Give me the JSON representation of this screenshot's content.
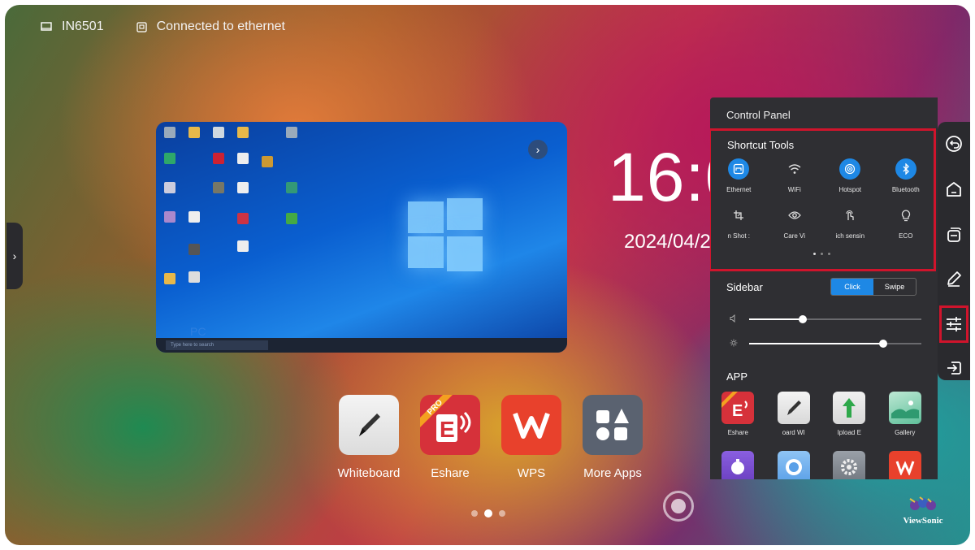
{
  "status_bar": {
    "device": "IN6501",
    "network": "Connected to ethernet"
  },
  "source_preview": {
    "label": "PC",
    "taskbar_search": "Type here to search"
  },
  "clock": {
    "time": "16:0",
    "date": "2024/04/2"
  },
  "home_apps": [
    {
      "label": "Whiteboard",
      "icon": "whiteboard-icon"
    },
    {
      "label": "Eshare",
      "icon": "eshare-icon",
      "badge": "PRO"
    },
    {
      "label": "WPS",
      "icon": "wps-icon"
    },
    {
      "label": "More Apps",
      "icon": "more-apps-icon"
    }
  ],
  "page_indicator": {
    "count": 3,
    "active": 2
  },
  "brand": "ViewSonic",
  "control_panel": {
    "title": "Control Panel",
    "shortcut_tools": {
      "title": "Shortcut Tools",
      "tools": [
        {
          "label": "Ethernet",
          "icon": "ethernet-icon",
          "active": true
        },
        {
          "label": "WiFi",
          "icon": "wifi-icon",
          "active": false
        },
        {
          "label": "Hotspot",
          "icon": "hotspot-icon",
          "active": true
        },
        {
          "label": "Bluetooth",
          "icon": "bluetooth-icon",
          "active": true
        },
        {
          "label": "n Shot   :",
          "icon": "screenshot-crop-icon",
          "active": false
        },
        {
          "label": "Care    Vi",
          "icon": "eye-care-icon",
          "active": false
        },
        {
          "label": "ich sensin",
          "icon": "touch-icon",
          "active": false
        },
        {
          "label": "ECO",
          "icon": "eco-bulb-icon",
          "active": false
        }
      ]
    },
    "sidebar": {
      "label": "Sidebar",
      "options": [
        "Click",
        "Swipe"
      ],
      "selected": "Click"
    },
    "volume_level": 0.31,
    "brightness_level": 0.78,
    "app_section": {
      "title": "APP",
      "apps": [
        {
          "label": "Eshare",
          "icon": "eshare-icon",
          "badge": "PRO"
        },
        {
          "label": "oard    WI",
          "icon": "whiteboard-icon"
        },
        {
          "label": "Ipload    E",
          "icon": "upload-icon"
        },
        {
          "label": "Gallery",
          "icon": "gallery-icon"
        },
        {
          "label": "",
          "icon": "timer-icon"
        },
        {
          "label": "",
          "icon": "record-icon"
        },
        {
          "label": "",
          "icon": "settings-icon"
        },
        {
          "label": "",
          "icon": "wps-icon"
        }
      ]
    }
  },
  "dock": [
    "back-icon",
    "home-icon",
    "multitask-icon",
    "pen-icon",
    "settings-sliders-icon",
    "input-source-icon"
  ],
  "colors": {
    "accent": "#1e88e5",
    "highlight": "#d0142c",
    "panel": "#2f2f33"
  }
}
